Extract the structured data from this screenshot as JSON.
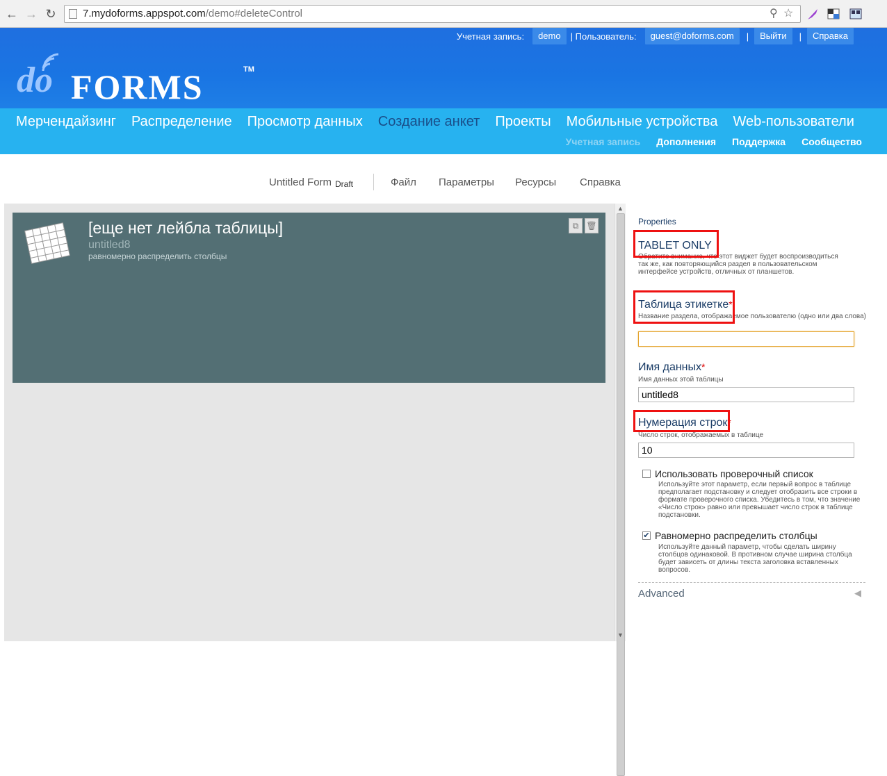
{
  "browser": {
    "url_host": "7.mydoforms.appspot.com",
    "url_path": "/demo#deleteControl"
  },
  "topbar": {
    "account_label": "Учетная запись:",
    "account_value": "demo",
    "user_label": "| Пользователь:",
    "user_value": "guest@doforms.com",
    "logout": "Выйти",
    "help": "Справка"
  },
  "logo": {
    "do": "do",
    "forms": "FORMS",
    "tm": "TM"
  },
  "mainnav": {
    "items": [
      "Мерчендайзинг",
      "Распределение",
      "Просмотр данных",
      "Создание анкет",
      "Проекты",
      "Мобильные устройства",
      "Web-пользователи"
    ],
    "active_index": 3
  },
  "subnav": {
    "items": [
      "Учетная запись",
      "Дополнения",
      "Поддержка",
      "Сообщество"
    ]
  },
  "formbar": {
    "title": "Untitled Form",
    "status": "Draft",
    "menu": [
      "Файл",
      "Параметры",
      "Ресурсы",
      "Справка"
    ]
  },
  "widget": {
    "title": "[еще нет лейбла таблицы]",
    "name": "untitled8",
    "description": "равномерно распределить столбцы",
    "icon": "table-grid-icon"
  },
  "properties": {
    "header": "Properties",
    "tablet_only": "TABLET ONLY",
    "tablet_help": "Обратите внимание, что этот виджет будет воспроизводиться так же, как повторяющийся раздел в пользовательском интерфейсе устройств, отличных от планшетов.",
    "table_label": "Таблица этикетке",
    "table_label_help": "Название раздела, отображаемое пользователю (одно или два слова)",
    "table_label_value": "",
    "data_name": "Имя данных",
    "data_name_help": "Имя данных этой таблицы",
    "data_name_value": "untitled8",
    "row_count": "Нумерация строк",
    "row_count_help": "Число строк, отображаемых в таблице",
    "row_count_value": "10",
    "checklist_label": "Использовать проверочный список",
    "checklist_checked": false,
    "checklist_help": "Используйте этот параметр, если первый вопрос в таблице предполагает подстановку и следует отобразить все строки в формате проверочного списка. Убедитесь в том, что значение «Число строк» равно или превышает число строк в таблице подстановки.",
    "even_columns_label": "Равномерно распределить столбцы",
    "even_columns_checked": true,
    "even_columns_help": "Используйте данный параметр, чтобы сделать ширину столбцов одинаковой. В противном случае ширина столбца будет зависеть от длины текста заголовка вставленных вопросов.",
    "advanced": "Advanced",
    "required_mark": "*"
  },
  "colors": {
    "header_blue": "#1a75e3",
    "nav_blue": "#27b2f0",
    "widget_bg": "#536f74",
    "highlight_red": "#ee1111"
  }
}
